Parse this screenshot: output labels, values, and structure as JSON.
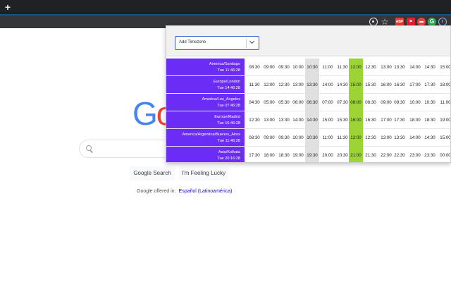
{
  "browser": {
    "new_tab_label": "+",
    "extensions": [
      "zoom-icon",
      "star-icon",
      "extension-red-icon",
      "extension-badge-icon",
      "extension-circle-red-icon",
      "extension-green-icon",
      "extension-power-icon"
    ]
  },
  "google": {
    "logo_visible": "Go",
    "search_button": "Google Search",
    "lucky_button": "I'm Feeling Lucky",
    "offered_in": "Google offered in:",
    "language_link": "Español (Latinoamérica)"
  },
  "popup": {
    "add_timezone_placeholder": "Add Timezone",
    "highlight_colors": {
      "grey": "#e0e0e0",
      "green": "#9bd434",
      "label": "#6b2cf5"
    },
    "timezones": [
      {
        "name": "America/Santiago",
        "time": "Tue 11:46:28",
        "hours": [
          "08:30",
          "09:00",
          "09:30",
          "10:00",
          "10:30",
          "11:00",
          "11:30",
          "12:00",
          "12:30",
          "13:00",
          "13:30",
          "14:00",
          "14:30",
          "15:00"
        ]
      },
      {
        "name": "Europe/London",
        "time": "Tue 14:46:28",
        "hours": [
          "11:30",
          "12:00",
          "12:30",
          "13:00",
          "13:30",
          "14:00",
          "14:30",
          "15:00",
          "15:30",
          "16:00",
          "16:30",
          "17:00",
          "17:30",
          "18:00"
        ]
      },
      {
        "name": "America/Los_Angeles",
        "time": "Tue 07:46:28",
        "hours": [
          "04:30",
          "05:00",
          "05:30",
          "06:00",
          "06:30",
          "07:00",
          "07:30",
          "08:00",
          "08:30",
          "09:00",
          "09:30",
          "10:00",
          "10:30",
          "11:00"
        ]
      },
      {
        "name": "Europe/Madrid",
        "time": "Tue 16:46:28",
        "hours": [
          "12:30",
          "13:00",
          "13:30",
          "14:00",
          "14:30",
          "15:00",
          "15:30",
          "16:00",
          "16:30",
          "17:00",
          "17:30",
          "18:00",
          "18:30",
          "19:00"
        ]
      },
      {
        "name": "America/Argentina/Buenos_Aires",
        "time": "Tue 11:46:28",
        "hours": [
          "08:30",
          "09:00",
          "09:30",
          "10:00",
          "10:30",
          "11:00",
          "11:30",
          "12:00",
          "12:30",
          "13:00",
          "13:30",
          "14:00",
          "14:30",
          "15:00"
        ]
      },
      {
        "name": "Asia/Kolkata",
        "time": "Tue 20:16:28",
        "hours": [
          "17:30",
          "18:00",
          "18:30",
          "19:00",
          "19:30",
          "20:00",
          "20:30",
          "21:00",
          "21:30",
          "22:00",
          "22:30",
          "23:00",
          "23:30",
          "00:00"
        ]
      }
    ]
  }
}
